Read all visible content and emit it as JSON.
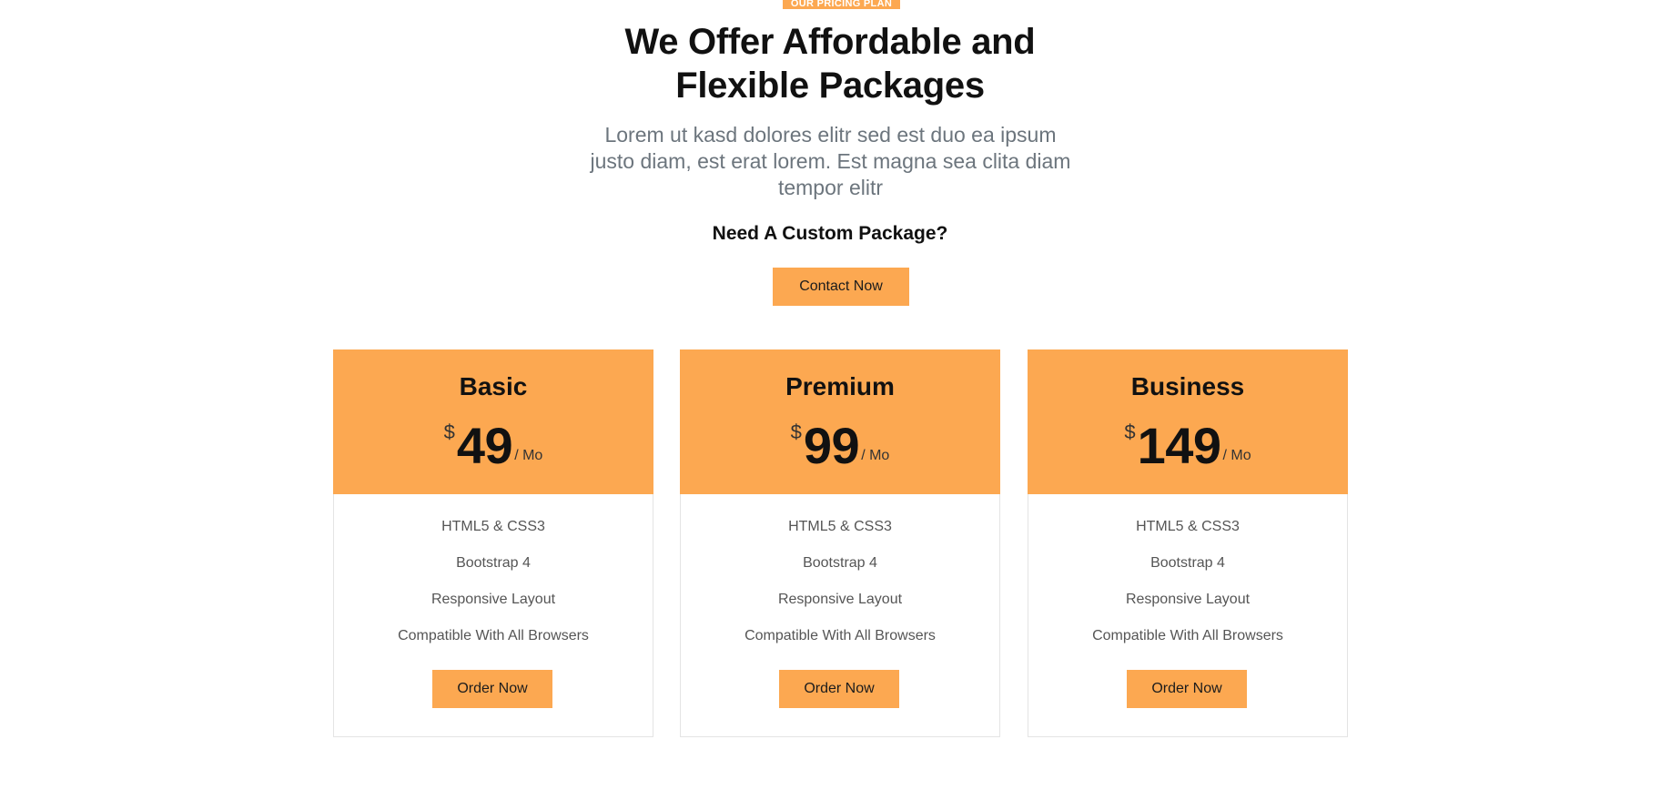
{
  "header": {
    "eyebrow": "OUR PRICING PLAN",
    "headline_line1": "We Offer Affordable and",
    "headline_line2": "Flexible Packages",
    "lead": "Lorem ut kasd dolores elitr sed est duo ea ipsum justo diam, est erat lorem. Est magna sea clita diam tempor elitr",
    "custom_question": "Need A Custom Package?",
    "contact_label": "Contact Now"
  },
  "plans": [
    {
      "name": "Basic",
      "currency": "$",
      "amount": "49",
      "period": "/ Mo",
      "features": [
        "HTML5 & CSS3",
        "Bootstrap 4",
        "Responsive Layout",
        "Compatible With All Browsers"
      ],
      "order_label": "Order Now"
    },
    {
      "name": "Premium",
      "currency": "$",
      "amount": "99",
      "period": "/ Mo",
      "features": [
        "HTML5 & CSS3",
        "Bootstrap 4",
        "Responsive Layout",
        "Compatible With All Browsers"
      ],
      "order_label": "Order Now"
    },
    {
      "name": "Business",
      "currency": "$",
      "amount": "149",
      "period": "/ Mo",
      "features": [
        "HTML5 & CSS3",
        "Bootstrap 4",
        "Responsive Layout",
        "Compatible With All Browsers"
      ],
      "order_label": "Order Now"
    }
  ],
  "colors": {
    "accent": "#FCA851",
    "heading": "#111111",
    "muted_text": "#6c757d",
    "card_border": "#e4e4e4"
  }
}
